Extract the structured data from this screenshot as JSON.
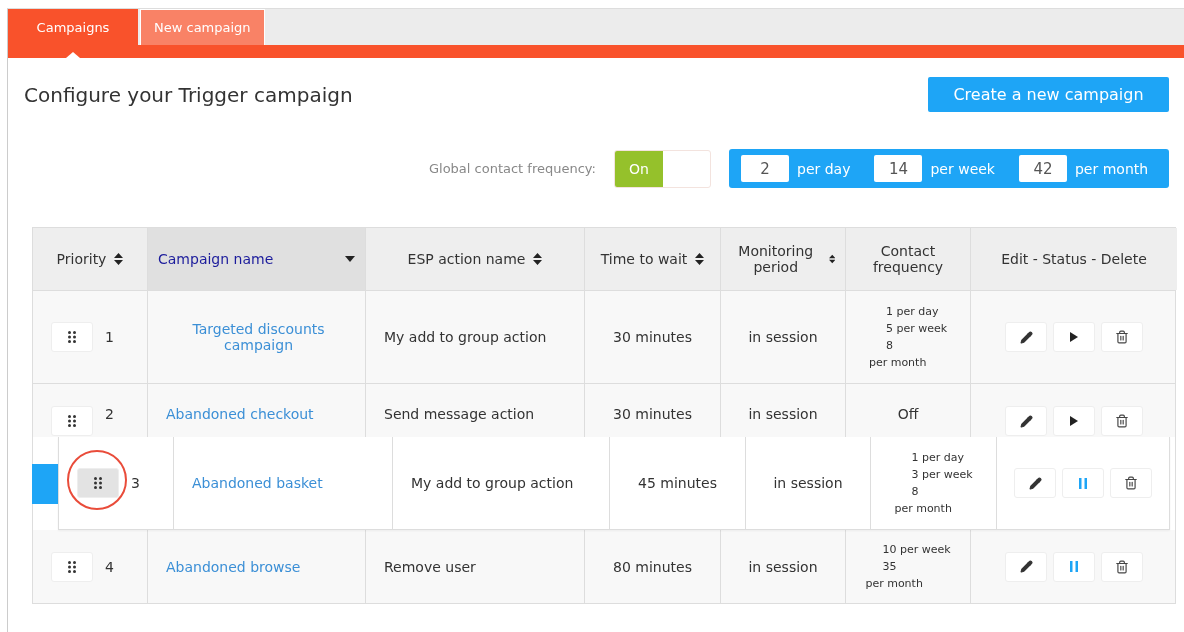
{
  "tabs": [
    {
      "label": "Campaigns",
      "selected": true
    },
    {
      "label": "New campaign",
      "selected": false
    }
  ],
  "title": "Configure your Trigger campaign",
  "create_button": "Create a new campaign",
  "global_frequency": {
    "label": "Global contact frequency:",
    "toggle": {
      "label": "On",
      "on": true
    },
    "fields": [
      {
        "value": "2",
        "unit": "per day"
      },
      {
        "value": "14",
        "unit": "per week"
      },
      {
        "value": "42",
        "unit": "per month"
      }
    ]
  },
  "table": {
    "columns": [
      {
        "label": "Priority",
        "sortable": true,
        "selected": false
      },
      {
        "label": "Campaign name",
        "sortable": true,
        "selected": true
      },
      {
        "label": "ESP action name",
        "sortable": true,
        "selected": false
      },
      {
        "label": "Time to wait",
        "sortable": true,
        "selected": false
      },
      {
        "label": "Monitoring period",
        "sortable": true,
        "selected": false
      },
      {
        "label": "Contact frequency",
        "sortable": false,
        "selected": false
      },
      {
        "label": "Edit - Status - Delete",
        "sortable": false,
        "selected": false
      }
    ],
    "rows": [
      {
        "priority": "1",
        "name": "Targeted discounts campaign",
        "action": "My add to group action",
        "wait": "30 minutes",
        "monitoring": "in session",
        "frequency": [
          "1 per day",
          "5 per week",
          "8",
          "per month"
        ],
        "running": false,
        "dragging": false
      },
      {
        "priority": "2",
        "name": "Abandoned checkout",
        "action": "Send message action",
        "wait": "30 minutes",
        "monitoring": "in session",
        "frequency": [
          "Off"
        ],
        "running": false,
        "dragging": false
      },
      {
        "priority": "3",
        "name": "Abandoned basket",
        "action": "My add to group action",
        "wait": "45 minutes",
        "monitoring": "in session",
        "frequency": [
          "1 per day",
          "3 per week",
          "8",
          "per month"
        ],
        "running": true,
        "dragging": true
      },
      {
        "priority": "4",
        "name": "Abandoned browse",
        "action": "Remove user",
        "wait": "80 minutes",
        "monitoring": "in session",
        "frequency": [
          "10 per week",
          "35",
          "per month"
        ],
        "running": true,
        "dragging": false
      }
    ]
  }
}
